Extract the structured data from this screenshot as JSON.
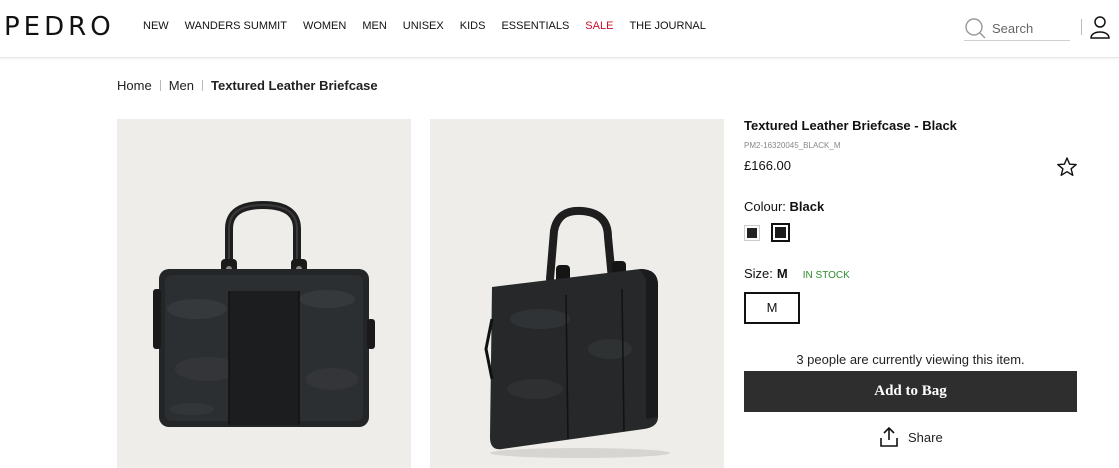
{
  "header": {
    "logo": "PEDRO",
    "nav": [
      "NEW",
      "WANDERS SUMMIT",
      "WOMEN",
      "MEN",
      "UNISEX",
      "KIDS",
      "ESSENTIALS",
      "SALE",
      "THE JOURNAL"
    ],
    "search_placeholder": "Search"
  },
  "breadcrumb": {
    "home": "Home",
    "category": "Men",
    "current": "Textured Leather Briefcase"
  },
  "product": {
    "title": "Textured Leather Briefcase - Black",
    "sku": "PM2-16320045_BLACK_M",
    "price": "£166.00",
    "colour_label": "Colour:",
    "colour_value": "Black",
    "size_label": "Size:",
    "size_value": "M",
    "stock_status": "IN STOCK",
    "size_option": "M",
    "viewers_text": "3 people are currently viewing this item.",
    "add_to_bag": "Add to Bag",
    "share": "Share"
  },
  "colors": {
    "sale": "#c8102e",
    "in_stock": "#2e8b2e",
    "button_bg": "#2e2e2e",
    "image_bg": "#eeedea"
  },
  "icons": [
    "search-icon",
    "user-icon",
    "star-outline-icon",
    "share-icon"
  ]
}
